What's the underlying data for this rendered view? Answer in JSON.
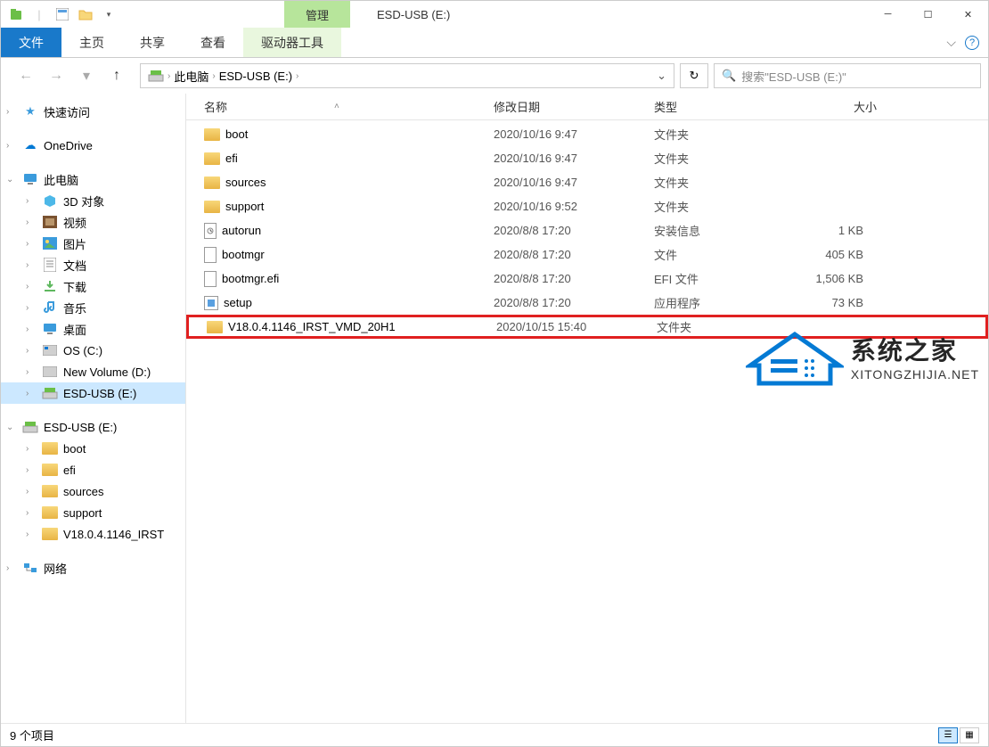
{
  "title": {
    "manage_tab": "管理",
    "window_title": "ESD-USB (E:)"
  },
  "ribbon": {
    "file": "文件",
    "home": "主页",
    "share": "共享",
    "view": "查看",
    "drive_tools": "驱动器工具"
  },
  "breadcrumb": {
    "thispc": "此电脑",
    "drive": "ESD-USB (E:)"
  },
  "search": {
    "placeholder": "搜索\"ESD-USB (E:)\""
  },
  "sidebar": {
    "quick": "快速访问",
    "onedrive": "OneDrive",
    "thispc": "此电脑",
    "pc_items": [
      "3D 对象",
      "视频",
      "图片",
      "文档",
      "下载",
      "音乐",
      "桌面",
      "OS (C:)",
      "New Volume (D:)",
      "ESD-USB (E:)"
    ],
    "drive_tree": "ESD-USB (E:)",
    "tree_items": [
      "boot",
      "efi",
      "sources",
      "support",
      "V18.0.4.1146_IRST"
    ],
    "network": "网络"
  },
  "columns": {
    "name": "名称",
    "date": "修改日期",
    "type": "类型",
    "size": "大小"
  },
  "rows": [
    {
      "icon": "folder",
      "name": "boot",
      "date": "2020/10/16 9:47",
      "type": "文件夹",
      "size": ""
    },
    {
      "icon": "folder",
      "name": "efi",
      "date": "2020/10/16 9:47",
      "type": "文件夹",
      "size": ""
    },
    {
      "icon": "folder",
      "name": "sources",
      "date": "2020/10/16 9:47",
      "type": "文件夹",
      "size": ""
    },
    {
      "icon": "folder",
      "name": "support",
      "date": "2020/10/16 9:52",
      "type": "文件夹",
      "size": ""
    },
    {
      "icon": "inf",
      "name": "autorun",
      "date": "2020/8/8 17:20",
      "type": "安装信息",
      "size": "1 KB"
    },
    {
      "icon": "file",
      "name": "bootmgr",
      "date": "2020/8/8 17:20",
      "type": "文件",
      "size": "405 KB"
    },
    {
      "icon": "file",
      "name": "bootmgr.efi",
      "date": "2020/8/8 17:20",
      "type": "EFI 文件",
      "size": "1,506 KB"
    },
    {
      "icon": "app",
      "name": "setup",
      "date": "2020/8/8 17:20",
      "type": "应用程序",
      "size": "73 KB"
    },
    {
      "icon": "folder",
      "name": "V18.0.4.1146_IRST_VMD_20H1",
      "date": "2020/10/15 15:40",
      "type": "文件夹",
      "size": "",
      "highlight": true
    }
  ],
  "status": {
    "count": "9 个项目"
  },
  "watermark": {
    "title": "系统之家",
    "url": "XITONGZHIJIA.NET"
  }
}
